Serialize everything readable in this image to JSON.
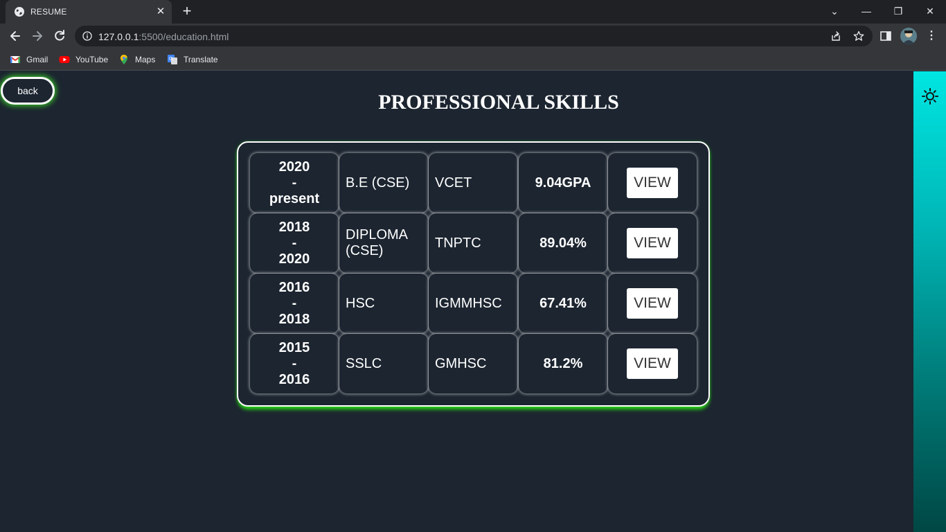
{
  "browser": {
    "tab_title": "RESUME",
    "tab_close": "✕",
    "new_tab": "+",
    "url_host": "127.0.0.1",
    "url_path": ":5500/education.html",
    "window_controls": {
      "tabsearch": "⌄",
      "minimize": "—",
      "restore": "❐",
      "close": "✕"
    },
    "menu": "⋮",
    "bookmarks": [
      {
        "label": "Gmail",
        "icon": "gmail-icon"
      },
      {
        "label": "YouTube",
        "icon": "youtube-icon"
      },
      {
        "label": "Maps",
        "icon": "maps-icon"
      },
      {
        "label": "Translate",
        "icon": "translate-icon"
      }
    ]
  },
  "page": {
    "back_label": "back",
    "title": "PROFESSIONAL SKILLS",
    "theme_icon": "sun-icon",
    "rows": [
      {
        "year_start": "2020",
        "dash": "-",
        "year_end": "present",
        "course": "B.E (CSE)",
        "institute": "VCET",
        "score": "9.04GPA",
        "action": "VIEW"
      },
      {
        "year_start": "2018",
        "dash": "-",
        "year_end": "2020",
        "course": "DIPLOMA (CSE)",
        "institute": "TNPTC",
        "score": "89.04%",
        "action": "VIEW"
      },
      {
        "year_start": "2016",
        "dash": "-",
        "year_end": "2018",
        "course": "HSC",
        "institute": "IGMMHSC",
        "score": "67.41%",
        "action": "VIEW"
      },
      {
        "year_start": "2015",
        "dash": "-",
        "year_end": "2016",
        "course": "SSLC",
        "institute": "GMHSC",
        "score": "81.2%",
        "action": "VIEW"
      }
    ]
  },
  "colors": {
    "page_bg": "#1c2530",
    "glow": "#3cdc28",
    "strip_top": "#00e6e2",
    "strip_bottom": "#004744"
  }
}
